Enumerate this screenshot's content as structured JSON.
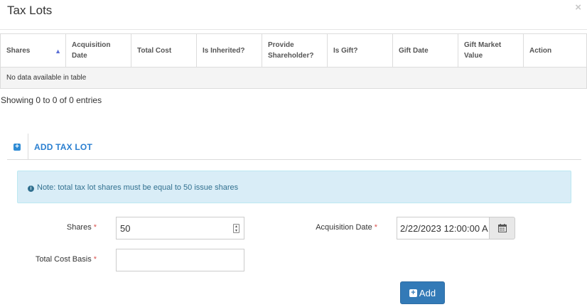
{
  "modal": {
    "title": "Tax Lots",
    "close_glyph": "×"
  },
  "table": {
    "columns": [
      "Shares",
      "Acquisition Date",
      "Total Cost",
      "Is Inherited?",
      "Provide Shareholder?",
      "Is Gift?",
      "Gift Date",
      "Gift Market Value",
      "Action"
    ],
    "sort_indicator": "▲",
    "empty_text": "No data available in table",
    "info_text": "Showing 0 to 0 of 0 entries"
  },
  "add_section": {
    "toggle_glyph": "+",
    "label": "ADD TAX LOT",
    "note_icon": "i",
    "note_text": "Note: total tax lot shares must be equal to 50 issue shares"
  },
  "form": {
    "shares_label": "Shares",
    "shares_value": "50",
    "acq_date_label": "Acquisition Date",
    "acq_date_value": "2/22/2023 12:00:00 A",
    "total_cost_label": "Total Cost Basis",
    "total_cost_value": "",
    "required_mark": "*"
  },
  "buttons": {
    "add_label": "Add",
    "add_icon": "+"
  },
  "colors": {
    "accent": "#337ab7",
    "link": "#2a7fd0",
    "note_bg": "#d9edf7",
    "note_text": "#31708f",
    "required": "#d9534f"
  }
}
